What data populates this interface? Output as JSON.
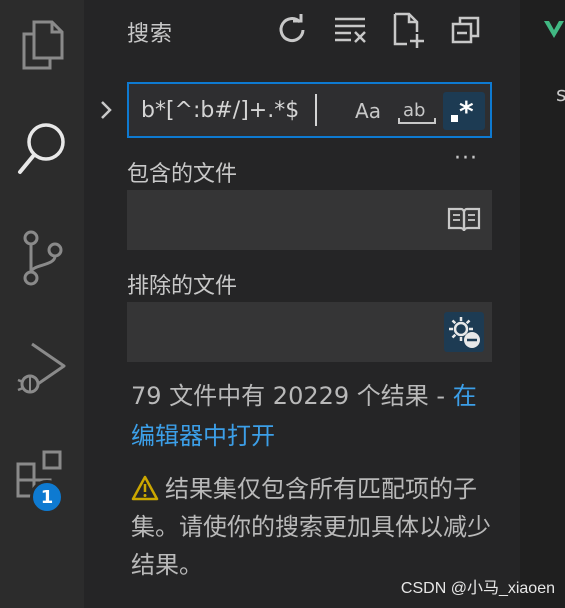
{
  "panel": {
    "title": "搜索"
  },
  "search": {
    "value": "b*[^:b#/]+.*$",
    "match_case_label": "Aa",
    "whole_word_label": "ab",
    "regex_label": ".*"
  },
  "more_label": "···",
  "include": {
    "label": "包含的文件"
  },
  "exclude": {
    "label": "排除的文件"
  },
  "results": {
    "summary": "79 文件中有 20229 个结果 - ",
    "open_in_editor": "在编辑器中打开"
  },
  "warning": {
    "text": "结果集仅包含所有匹配项的子集。请使你的搜索更加具体以减少结果。"
  },
  "activity": {
    "badge_count": "1"
  },
  "editor": {
    "tab_letter": "s"
  },
  "watermark": "CSDN @小马_xiaoen",
  "colors": {
    "accent": "#0e7ad1",
    "link": "#3c9fe8",
    "warning": "#cca700"
  }
}
